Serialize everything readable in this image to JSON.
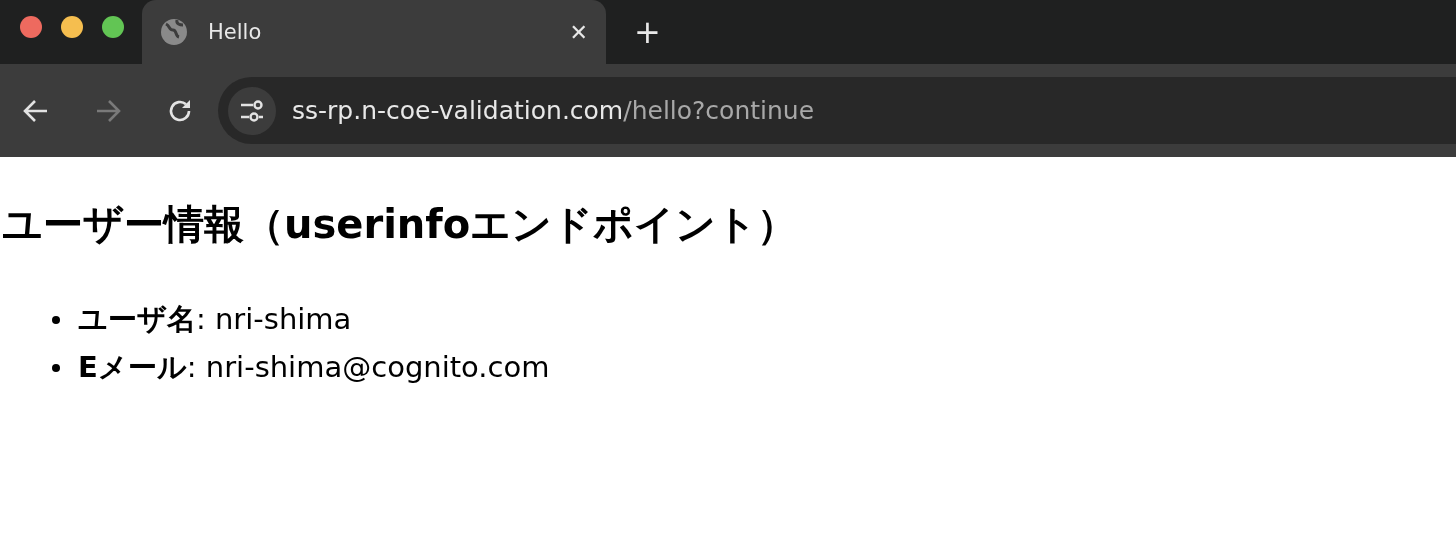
{
  "tabs": [
    {
      "title": "Hello",
      "selected": true,
      "close": "✕"
    }
  ],
  "new_tab": "+",
  "nav": [
    {
      "kind": "back",
      "disabled": false
    },
    {
      "kind": "forward",
      "disabled": true
    },
    {
      "kind": "reload",
      "disabled": false
    }
  ],
  "address_bar": {
    "host": "ss-rp.n-coe-validation.com",
    "path": "/hello?continue"
  },
  "page": {
    "heading": "ユーザー情報（userinfoエンドポイント）",
    "items": [
      "**ユーザ名**: nri-shima",
      "**Eメール**: nri-shima@cognito.com"
    ]
  }
}
